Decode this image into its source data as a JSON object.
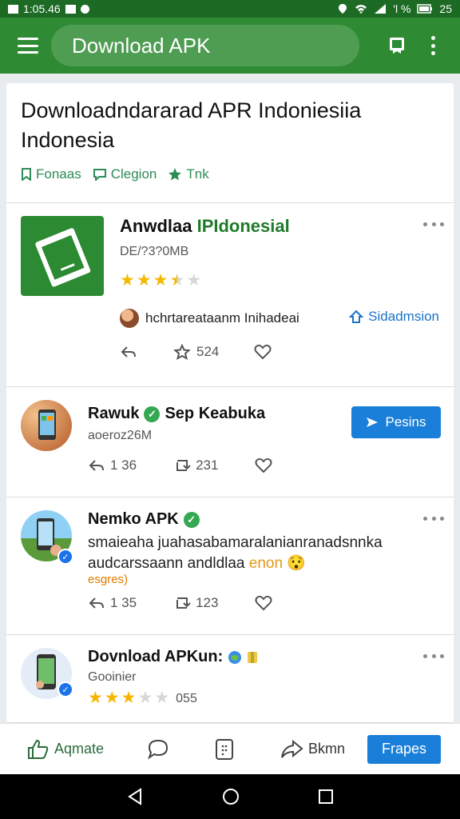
{
  "status_bar": {
    "time": "1:05.46",
    "battery": "25",
    "signal_text": "'l %"
  },
  "app_bar": {
    "search_text": "Download APK"
  },
  "header": {
    "title": "Downloadndararad APR Indoniesiia Indonesia",
    "chips": [
      "Fonaas",
      "Clegion",
      "Tnk"
    ]
  },
  "post1": {
    "title_main": "Anwdlaa ",
    "title_green": "IPIdonesial",
    "subtitle": "DE/?3?0MB",
    "rating_stars": 3.5,
    "author": "hchrtareataanm Inihadeai",
    "action_link": "Sidadmsion",
    "share_count": "524"
  },
  "post2": {
    "name": "Rawuk",
    "name_suffix": "Sep Keabuka",
    "handle": "aoeroz26M",
    "button_label": "Pesins",
    "reply_count": "1 36",
    "repost_count": "231"
  },
  "post3": {
    "name": "Nemko APK",
    "body_line1": "smaieaha juahasabamaralanianranadsnnka",
    "body_line2": "audcarssaann andldlaa",
    "body_emoji_text": "enon",
    "emoji": "😯",
    "hashtag": "esgres)",
    "reply_count": "1 35",
    "repost_count": "123"
  },
  "post4": {
    "name": "Dovnload APKun:",
    "handle": "Gooinier",
    "rating_stars": 3,
    "count": "055"
  },
  "bottom_bar": {
    "like_label": "Aqmate",
    "share_label": "Bkmn",
    "primary_label": "Frapes"
  },
  "colors": {
    "app_bar": "#2e8b33",
    "status_bar": "#1c6a24",
    "accent_blue": "#1a7fd8",
    "star": "#f5b800",
    "chip_green": "#2e8b57"
  },
  "icons": [
    "menu-icon",
    "book-icon",
    "more-vert-icon",
    "bookmark-icon",
    "comment-icon",
    "star-icon",
    "reply-icon",
    "repost-icon",
    "heart-icon",
    "verified-icon",
    "share-icon",
    "message-icon",
    "back-icon",
    "home-icon",
    "recents-icon"
  ]
}
